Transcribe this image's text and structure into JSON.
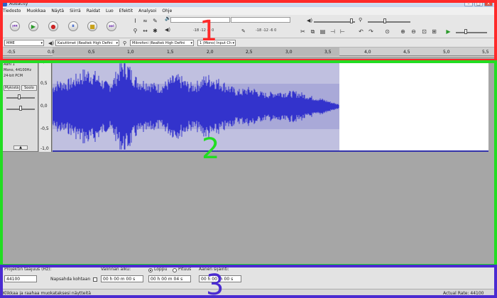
{
  "window": {
    "title": "Audacity"
  },
  "menu": [
    "Tiedosto",
    "Muokkaa",
    "Näytä",
    "Siirrä",
    "Raidat",
    "Luo",
    "Efektit",
    "Analysoi",
    "Ohje"
  ],
  "meters": {
    "playback_scale": "-18  -12  -6  0",
    "record_scale": "-18  -12  -6  0",
    "lr": "L\nR"
  },
  "device": {
    "host": "MME",
    "output": "Kaiuttimet (Realtek High Defini",
    "input": "Mikrofoni (Realtek High Defini",
    "channels": "1 (Mono) Input Ch"
  },
  "ruler": {
    "ticks": [
      "-0,5",
      "0,0",
      "0,5",
      "1,0",
      "1,5",
      "2,0",
      "2,5",
      "3,0",
      "3,5",
      "4,0",
      "4,5",
      "5,0",
      "5,5"
    ]
  },
  "track": {
    "name": "Ääni 1",
    "format_line1": "Mono, 44100Hz",
    "format_line2": "24-bit PCM",
    "mute": "Mykistä",
    "solo": "Soolo",
    "collapse": "▲",
    "y_labels": [
      "1,0",
      "0,5",
      "0,0",
      "-0,5",
      "-1,0"
    ]
  },
  "selection_toolbar": {
    "project_rate_label": "Projektin taajuus (Hz):",
    "project_rate": "44100",
    "snap_label": "Napsahda kohtaan",
    "selection_start_label": "Valinnan alku:",
    "selection_start": "00 h 00 m 00 s",
    "end_label": "Loppu",
    "length_label": "Pituus",
    "selection_end": "00 h 00 m 04 s",
    "audio_position_label": "Äänen sijainti:",
    "audio_position": "00 h 00 m 00 s"
  },
  "status": {
    "left": "Klikkaa ja raahaa muokataksesi näytteitä",
    "right": "Actual Rate: 44100"
  },
  "annotations": [
    {
      "number": "1",
      "color": "#ff2a2a"
    },
    {
      "number": "2",
      "color": "#22dd22"
    },
    {
      "number": "3",
      "color": "#4a2bd1"
    }
  ],
  "colors": {
    "waveform": "#3333cc",
    "selection_bg": "#c0c0e0"
  }
}
